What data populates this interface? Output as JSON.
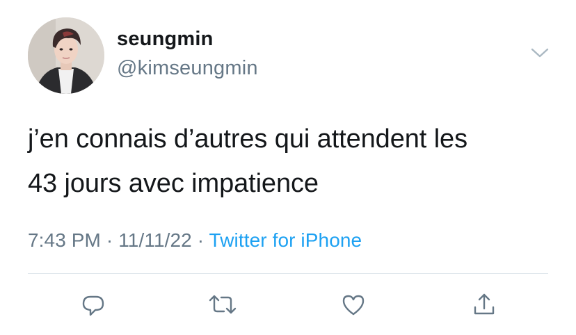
{
  "user": {
    "display_name": "seungmin",
    "handle": "@kimseungmin"
  },
  "tweet": {
    "text_line1": "j’en connais d’autres qui attendent les",
    "text_line2": "43 jours avec impatience",
    "time": "7:43 PM",
    "separator": "·",
    "date": "11/11/22",
    "source": "Twitter for iPhone"
  },
  "actions": [
    "reply",
    "retweet",
    "like",
    "share"
  ],
  "icons": {
    "caret": "chevron-down-icon",
    "reply": "reply-icon",
    "retweet": "retweet-icon",
    "like": "heart-icon",
    "share": "share-icon"
  },
  "colors": {
    "text": "#14171a",
    "muted": "#657786",
    "link": "#1da1f2",
    "divider": "#e1e8ed"
  }
}
